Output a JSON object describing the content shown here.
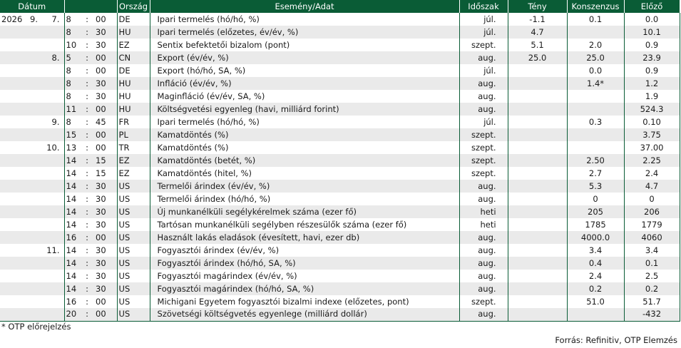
{
  "headers": {
    "datum": "Dátum",
    "orszag": "Ország",
    "esemeny": "Esemény/Adat",
    "idoszak": "Időszak",
    "teny": "Tény",
    "konszenzus": "Konszenzus",
    "elozo": "Előző"
  },
  "rows": [
    {
      "year": "2026",
      "month": "9.",
      "day": "7.",
      "hh": "8",
      "sep": ":",
      "mm": "00",
      "country": "DE",
      "event": "Ipari termelés (hó/hó, %)",
      "period": "júl.",
      "actual": "-1.1",
      "consensus": "0.1",
      "previous": "0.0"
    },
    {
      "year": "",
      "month": "",
      "day": "",
      "hh": "8",
      "sep": ":",
      "mm": "30",
      "country": "HU",
      "event": "Ipari termelés (előzetes, év/év, %)",
      "period": "júl.",
      "actual": "4.7",
      "consensus": "",
      "previous": "10.1"
    },
    {
      "year": "",
      "month": "",
      "day": "",
      "hh": "10",
      "sep": ":",
      "mm": "30",
      "country": "EZ",
      "event": "Sentix befektetői bizalom (pont)",
      "period": "szept.",
      "actual": "5.1",
      "consensus": "2.0",
      "previous": "0.9"
    },
    {
      "year": "",
      "month": "",
      "day": "8.",
      "hh": "5",
      "sep": ":",
      "mm": "00",
      "country": "CN",
      "event": "Export (év/év, %)",
      "period": "aug.",
      "actual": "25.0",
      "consensus": "25.0",
      "previous": "23.9"
    },
    {
      "year": "",
      "month": "",
      "day": "",
      "hh": "8",
      "sep": ":",
      "mm": "00",
      "country": "DE",
      "event": "Export (hó/hó, SA, %)",
      "period": "júl.",
      "actual": "",
      "consensus": "0.0",
      "previous": "0.9"
    },
    {
      "year": "",
      "month": "",
      "day": "",
      "hh": "8",
      "sep": ":",
      "mm": "30",
      "country": "HU",
      "event": "Infláció (év/év, %)",
      "period": "aug.",
      "actual": "",
      "consensus": "1.4*",
      "previous": "1.2"
    },
    {
      "year": "",
      "month": "",
      "day": "",
      "hh": "8",
      "sep": ":",
      "mm": "30",
      "country": "HU",
      "event": "Maginfláció (év/év, SA, %)",
      "period": "aug.",
      "actual": "",
      "consensus": "",
      "previous": "1.9"
    },
    {
      "year": "",
      "month": "",
      "day": "",
      "hh": "11",
      "sep": ":",
      "mm": "00",
      "country": "HU",
      "event": "Költségvetési egyenleg (havi, milliárd forint)",
      "period": "aug.",
      "actual": "",
      "consensus": "",
      "previous": "524.3"
    },
    {
      "year": "",
      "month": "",
      "day": "9.",
      "hh": "8",
      "sep": ":",
      "mm": "45",
      "country": "FR",
      "event": "Ipari termelés  (hó/hó, %)",
      "period": "júl.",
      "actual": "",
      "consensus": "0.3",
      "previous": "0.10"
    },
    {
      "year": "",
      "month": "",
      "day": "",
      "hh": "15",
      "sep": ":",
      "mm": "00",
      "country": "PL",
      "event": "Kamatdöntés (%)",
      "period": "szept.",
      "actual": "",
      "consensus": "",
      "previous": "3.75"
    },
    {
      "year": "",
      "month": "",
      "day": "10.",
      "hh": "13",
      "sep": ":",
      "mm": "00",
      "country": "TR",
      "event": "Kamatdöntés (%)",
      "period": "szept.",
      "actual": "",
      "consensus": "",
      "previous": "37.00"
    },
    {
      "year": "",
      "month": "",
      "day": "",
      "hh": "14",
      "sep": ":",
      "mm": "15",
      "country": "EZ",
      "event": "Kamatdöntés (betét, %)",
      "period": "szept.",
      "actual": "",
      "consensus": "2.50",
      "previous": "2.25"
    },
    {
      "year": "",
      "month": "",
      "day": "",
      "hh": "14",
      "sep": ":",
      "mm": "15",
      "country": "EZ",
      "event": "Kamatdöntés (hitel, %)",
      "period": "szept.",
      "actual": "",
      "consensus": "2.7",
      "previous": "2.4"
    },
    {
      "year": "",
      "month": "",
      "day": "",
      "hh": "14",
      "sep": ":",
      "mm": "30",
      "country": "US",
      "event": "Termelői árindex (év/év, %)",
      "period": "aug.",
      "actual": "",
      "consensus": "5.3",
      "previous": "4.7"
    },
    {
      "year": "",
      "month": "",
      "day": "",
      "hh": "14",
      "sep": ":",
      "mm": "30",
      "country": "US",
      "event": "Termelői árindex (hó/hó, %)",
      "period": "aug.",
      "actual": "",
      "consensus": "0",
      "previous": "0"
    },
    {
      "year": "",
      "month": "",
      "day": "",
      "hh": "14",
      "sep": ":",
      "mm": "30",
      "country": "US",
      "event": "Új munkanélküli segélykérelmek száma (ezer fő)",
      "period": "heti",
      "actual": "",
      "consensus": "205",
      "previous": "206"
    },
    {
      "year": "",
      "month": "",
      "day": "",
      "hh": "14",
      "sep": ":",
      "mm": "30",
      "country": "US",
      "event": "Tartósan munkanélküli segélyben részesülők száma (ezer fő)",
      "period": "heti",
      "actual": "",
      "consensus": "1785",
      "previous": "1779"
    },
    {
      "year": "",
      "month": "",
      "day": "",
      "hh": "16",
      "sep": ":",
      "mm": "00",
      "country": "US",
      "event": "Használt lakás eladások (évesített, havi, ezer db)",
      "period": "aug.",
      "actual": "",
      "consensus": "4000.0",
      "previous": "4060"
    },
    {
      "year": "",
      "month": "",
      "day": "11.",
      "hh": "14",
      "sep": ":",
      "mm": "30",
      "country": "US",
      "event": "Fogyasztói árindex (év/év, %)",
      "period": "aug.",
      "actual": "",
      "consensus": "3.4",
      "previous": "3.4"
    },
    {
      "year": "",
      "month": "",
      "day": "",
      "hh": "14",
      "sep": ":",
      "mm": "30",
      "country": "US",
      "event": "Fogyasztói árindex (hó/hó, SA, %)",
      "period": "aug.",
      "actual": "",
      "consensus": "0.4",
      "previous": "0.1"
    },
    {
      "year": "",
      "month": "",
      "day": "",
      "hh": "14",
      "sep": ":",
      "mm": "30",
      "country": "US",
      "event": "Fogyasztói magárindex (év/év, %)",
      "period": "aug.",
      "actual": "",
      "consensus": "2.4",
      "previous": "2.5"
    },
    {
      "year": "",
      "month": "",
      "day": "",
      "hh": "14",
      "sep": ":",
      "mm": "30",
      "country": "US",
      "event": "Fogyasztói magárindex (hó/hó, SA, %)",
      "period": "aug.",
      "actual": "",
      "consensus": "0.2",
      "previous": "0.2"
    },
    {
      "year": "",
      "month": "",
      "day": "",
      "hh": "16",
      "sep": ":",
      "mm": "00",
      "country": "US",
      "event": "Michigani Egyetem fogyasztói bizalmi indexe (előzetes, pont)",
      "period": "szept.",
      "actual": "",
      "consensus": "51.0",
      "previous": "51.7"
    },
    {
      "year": "",
      "month": "",
      "day": "",
      "hh": "20",
      "sep": ":",
      "mm": "00",
      "country": "US",
      "event": "Szövetségi költségvetés egyenlege (milliárd dollár)",
      "period": "aug.",
      "actual": "",
      "consensus": "",
      "previous": "-432"
    }
  ],
  "footnote": "* OTP előrejelzés",
  "source": "Forrás: Refinitiv, OTP Elemzés"
}
